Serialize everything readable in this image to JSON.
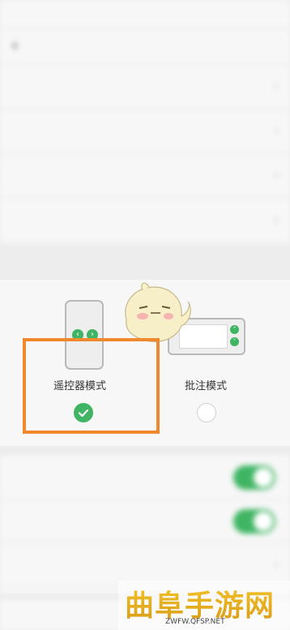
{
  "status_bar": {
    "carrier": "",
    "right": ""
  },
  "nav": {
    "back": "‹",
    "title": ""
  },
  "settings_rows": [
    {
      "label": "",
      "chevron": "›"
    },
    {
      "label": "",
      "chevron": "›"
    },
    {
      "label": "",
      "chevron": "›"
    },
    {
      "label": "",
      "value": "",
      "chevron": "›"
    }
  ],
  "section_label": "",
  "modes": {
    "remote": {
      "label": "遥控器模式",
      "selected": true
    },
    "annotate": {
      "label": "批注模式",
      "selected": false
    }
  },
  "toggle_rows": [
    {
      "label": "",
      "on": true
    },
    {
      "label": "",
      "on": true
    },
    {
      "label": "",
      "chevron": "›"
    }
  ],
  "bottom_row": {
    "label": ""
  },
  "watermark": {
    "text": "曲阜手游网",
    "url": "ZWFW.QFSP.NET"
  },
  "colors": {
    "accent": "#3fb563",
    "highlight": "#f0882e"
  },
  "icons": {
    "check": "✓",
    "arrow_left": "‹",
    "arrow_right": "›",
    "arrow_up": "˄",
    "arrow_down": "˅"
  }
}
